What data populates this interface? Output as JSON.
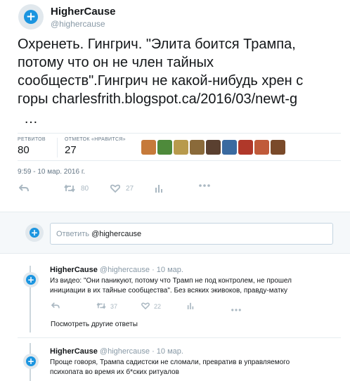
{
  "tweet": {
    "author_name": "HigherCause",
    "author_handle": "@highercause",
    "text_lines": [
      "Охренеть. Гингрич. \"Элита боится Трампа,",
      "потому что он не член тайных",
      "сообществ\".Гингрич не какой-нибудь хрен с"
    ],
    "text_link_prefix": "горы ",
    "link_text": "charlesfrith.blogspot.ca/2016/03/newt-g",
    "ellipsis": "…",
    "retweets_label": "РЕТВИТОВ",
    "retweets_count": "80",
    "likes_label": "ОТМЕТОК «НРАВИТСЯ»",
    "likes_count": "27",
    "timestamp": "9:59 - 10 мар. 2016 г.",
    "action_retweet_count": "80",
    "action_like_count": "27",
    "liker_colors": [
      "#c67a3a",
      "#4e8a3b",
      "#b89a4c",
      "#8a6a3a",
      "#5a4030",
      "#3a6aa0",
      "#b0382a",
      "#c05a3a",
      "#7a4a2a"
    ]
  },
  "reply_box": {
    "placeholder": "Ответить ",
    "mention": "@highercause"
  },
  "replies": [
    {
      "name": "HigherCause",
      "meta": "@highercause · 10 мар.",
      "lines": [
        "Из видео: \"Они паникуют, потому что Трамп не под контролем, не прошел",
        "инициации в их тайные сообщества\". Без всяких экивоков, правду-матку"
      ],
      "retweets": "37",
      "likes": "22"
    },
    {
      "name": "HigherCause",
      "meta": "@highercause · 10 мар.",
      "lines": [
        "Проще говоря, Трампа садистски не сломали, превратив в управляемого",
        "психопата во время их б*ских ритуалов"
      ]
    }
  ],
  "more_replies": "Посмотреть другие ответы",
  "colors": {
    "accent": "#1b95e0",
    "muted": "#8899a6",
    "border": "#e6ecf0"
  },
  "icons": [
    "plus-icon",
    "reply-icon",
    "retweet-icon",
    "heart-icon",
    "stats-icon",
    "more-icon"
  ]
}
